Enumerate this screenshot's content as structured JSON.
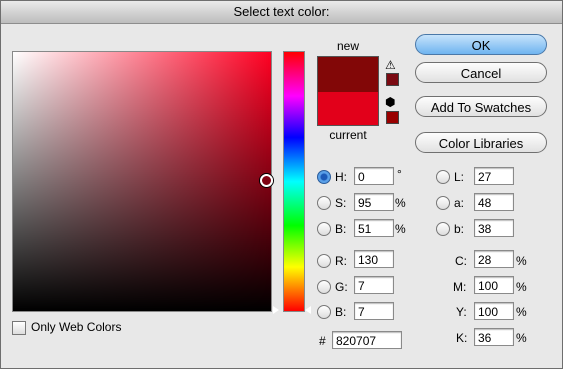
{
  "dialog": {
    "title": "Select text color:"
  },
  "swatches": {
    "new_label": "new",
    "current_label": "current",
    "new_color": "#820707",
    "current_color": "#e2001a"
  },
  "buttons": {
    "ok": "OK",
    "cancel": "Cancel",
    "add_to_swatches": "Add To Swatches",
    "color_libraries": "Color Libraries"
  },
  "hsb": {
    "h_label": "H:",
    "h": "0",
    "h_unit": "°",
    "s_label": "S:",
    "s": "95",
    "s_unit": "%",
    "b_label": "B:",
    "b": "51",
    "b_unit": "%"
  },
  "rgb": {
    "r_label": "R:",
    "r": "130",
    "g_label": "G:",
    "g": "7",
    "b_label": "B:",
    "b": "7"
  },
  "lab": {
    "l_label": "L:",
    "l": "27",
    "a_label": "a:",
    "a": "48",
    "b_label": "b:",
    "b": "38"
  },
  "cmyk": {
    "c_label": "C:",
    "c": "28",
    "m_label": "M:",
    "m": "100",
    "y_label": "Y:",
    "y": "100",
    "k_label": "K:",
    "k": "36",
    "unit": "%"
  },
  "hex": {
    "label": "#",
    "value": "820707"
  },
  "web_only": {
    "label": "Only Web Colors",
    "checked": false
  },
  "icons": {
    "gamut_warning": "warning-icon",
    "web_safe": "cube-icon"
  }
}
